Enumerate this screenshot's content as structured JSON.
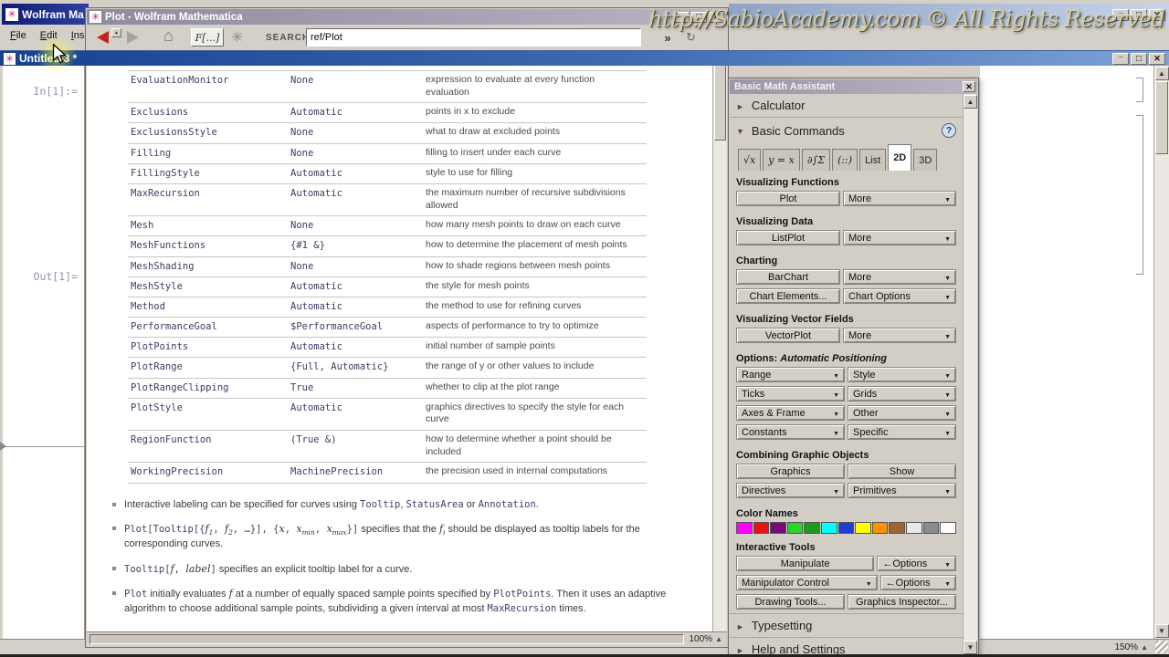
{
  "watermark": {
    "text": "http://SabioAcademy.com © All Rights Reserved"
  },
  "app_window": {
    "title": "Wolfram Ma",
    "menus": [
      "File",
      "Edit",
      "Inser"
    ]
  },
  "notebook": {
    "title": "Untitled-3 *",
    "in_label": "In[1]:=",
    "out_label": "Out[1]=",
    "zoom": "150%"
  },
  "doc_window": {
    "title": "Plot - Wolfram Mathematica",
    "toolbar": {
      "function_browser": "F[...]",
      "search_label": "SEARCH",
      "search_value": "ref/Plot",
      "more_button": "»"
    },
    "zoom": "100%",
    "table_rows": [
      [
        "EvaluationMonitor",
        "None",
        "expression to evaluate at every function evaluation"
      ],
      [
        "Exclusions",
        "Automatic",
        "points in x to exclude"
      ],
      [
        "ExclusionsStyle",
        "None",
        "what to draw at excluded points"
      ],
      [
        "Filling",
        "None",
        "filling to insert under each curve"
      ],
      [
        "FillingStyle",
        "Automatic",
        "style to use for filling"
      ],
      [
        "MaxRecursion",
        "Automatic",
        "the maximum number of recursive subdivisions allowed"
      ],
      [
        "Mesh",
        "None",
        "how many mesh points to draw on each curve"
      ],
      [
        "MeshFunctions",
        "{#1 &}",
        "how to determine the placement of mesh points"
      ],
      [
        "MeshShading",
        "None",
        "how to shade regions between mesh points"
      ],
      [
        "MeshStyle",
        "Automatic",
        "the style for mesh points"
      ],
      [
        "Method",
        "Automatic",
        "the method to use for refining curves"
      ],
      [
        "PerformanceGoal",
        "$PerformanceGoal",
        "aspects of performance to try to optimize"
      ],
      [
        "PlotPoints",
        "Automatic",
        "initial number of sample points"
      ],
      [
        "PlotRange",
        "{Full, Automatic}",
        "the range of y or other values to include"
      ],
      [
        "PlotRangeClipping",
        "True",
        "whether to clip at the plot range"
      ],
      [
        "PlotStyle",
        "Automatic",
        "graphics directives to specify the style for each curve"
      ],
      [
        "RegionFunction",
        "(True &)",
        "how to determine whether a point should be included"
      ],
      [
        "WorkingPrecision",
        "MachinePrecision",
        "the precision used in internal computations"
      ]
    ],
    "bullets": [
      [
        {
          "s": "p",
          "t": "Interactive labeling can be specified for curves using "
        },
        {
          "s": "c",
          "t": "Tooltip"
        },
        {
          "s": "p",
          "t": ", "
        },
        {
          "s": "c",
          "t": "StatusArea"
        },
        {
          "s": "p",
          "t": " or "
        },
        {
          "s": "c",
          "t": "Annotation"
        },
        {
          "s": "p",
          "t": "."
        }
      ],
      [
        {
          "s": "c",
          "t": "Plot[Tooltip[{"
        },
        {
          "s": "i",
          "t": "f"
        },
        {
          "s": "s",
          "t": "1"
        },
        {
          "s": "c",
          "t": ", "
        },
        {
          "s": "i",
          "t": "f"
        },
        {
          "s": "s",
          "t": "2"
        },
        {
          "s": "c",
          "t": ", …}], {"
        },
        {
          "s": "i",
          "t": "x"
        },
        {
          "s": "c",
          "t": ", "
        },
        {
          "s": "i",
          "t": "x"
        },
        {
          "s": "s",
          "t": "min"
        },
        {
          "s": "c",
          "t": ", "
        },
        {
          "s": "i",
          "t": "x"
        },
        {
          "s": "s",
          "t": "max"
        },
        {
          "s": "c",
          "t": "}]"
        },
        {
          "s": "p",
          "t": " specifies that the "
        },
        {
          "s": "i",
          "t": "f"
        },
        {
          "s": "s",
          "t": "i"
        },
        {
          "s": "p",
          "t": " should be displayed as tooltip labels for the corresponding curves."
        }
      ],
      [
        {
          "s": "c",
          "t": "Tooltip["
        },
        {
          "s": "i",
          "t": "f"
        },
        {
          "s": "c",
          "t": ", "
        },
        {
          "s": "i",
          "t": "label"
        },
        {
          "s": "c",
          "t": "]"
        },
        {
          "s": "p",
          "t": " specifies an explicit tooltip label for a curve."
        }
      ],
      [
        {
          "s": "c",
          "t": "Plot"
        },
        {
          "s": "p",
          "t": " initially evaluates "
        },
        {
          "s": "i",
          "t": "f"
        },
        {
          "s": "p",
          "t": " at a number of equally spaced sample points specified by "
        },
        {
          "s": "c",
          "t": "PlotPoints"
        },
        {
          "s": "p",
          "t": ". Then it uses an adaptive algorithm to choose additional sample points, subdividing a given interval at most "
        },
        {
          "s": "c",
          "t": "MaxRecursion"
        },
        {
          "s": "p",
          "t": " times."
        }
      ]
    ]
  },
  "palette": {
    "title": "Basic Math Assistant",
    "calculator": "Calculator",
    "basic_commands": "Basic Commands",
    "help_button": "?",
    "tabs": [
      "√x",
      "y = x",
      "∂∫Σ",
      "(::)",
      "List",
      "2D",
      "3D"
    ],
    "active_tab": "2D",
    "plain_tabs": [
      "List",
      "2D",
      "3D"
    ],
    "groups": {
      "visualizing_functions": {
        "header": "Visualizing Functions",
        "button": "Plot",
        "dropdown": "More"
      },
      "visualizing_data": {
        "header": "Visualizing Data",
        "button": "ListPlot",
        "dropdown": "More"
      },
      "charting": {
        "header": "Charting",
        "button": "BarChart",
        "dropdown": "More",
        "button2": "Chart Elements...",
        "dropdown2": "Chart Options"
      },
      "vector_fields": {
        "header": "Visualizing Vector Fields",
        "button": "VectorPlot",
        "dropdown": "More"
      },
      "options": {
        "header_prefix": "Options: ",
        "header_italic": "Automatic Positioning",
        "dropdowns": [
          [
            "Range",
            "Style"
          ],
          [
            "Ticks",
            "Grids"
          ],
          [
            "Axes & Frame",
            "Other"
          ],
          [
            "Constants",
            "Specific"
          ]
        ]
      },
      "combining": {
        "header": "Combining Graphic Objects",
        "buttons": [
          "Graphics",
          "Show"
        ],
        "dropdowns": [
          "Directives",
          "Primitives"
        ]
      },
      "color_names": {
        "header": "Color Names",
        "swatches": [
          "#ff00ff",
          "#e81313",
          "#760d76",
          "#2bd32b",
          "#1d9b1d",
          "#00ffff",
          "#1f3fd4",
          "#ffff00",
          "#ff9000",
          "#9c6430",
          "#e9e9e9",
          "#8c8c8c",
          "#ffffff"
        ]
      },
      "interactive_tools": {
        "header": "Interactive Tools",
        "manipulate": "Manipulate",
        "options1": "←Options",
        "manipulator_control": "Manipulator Control",
        "options2": "←Options",
        "drawing_tools": "Drawing Tools...",
        "graphics_inspector": "Graphics Inspector..."
      }
    },
    "typesetting": "Typesetting",
    "help_and_settings": "Help and Settings"
  }
}
